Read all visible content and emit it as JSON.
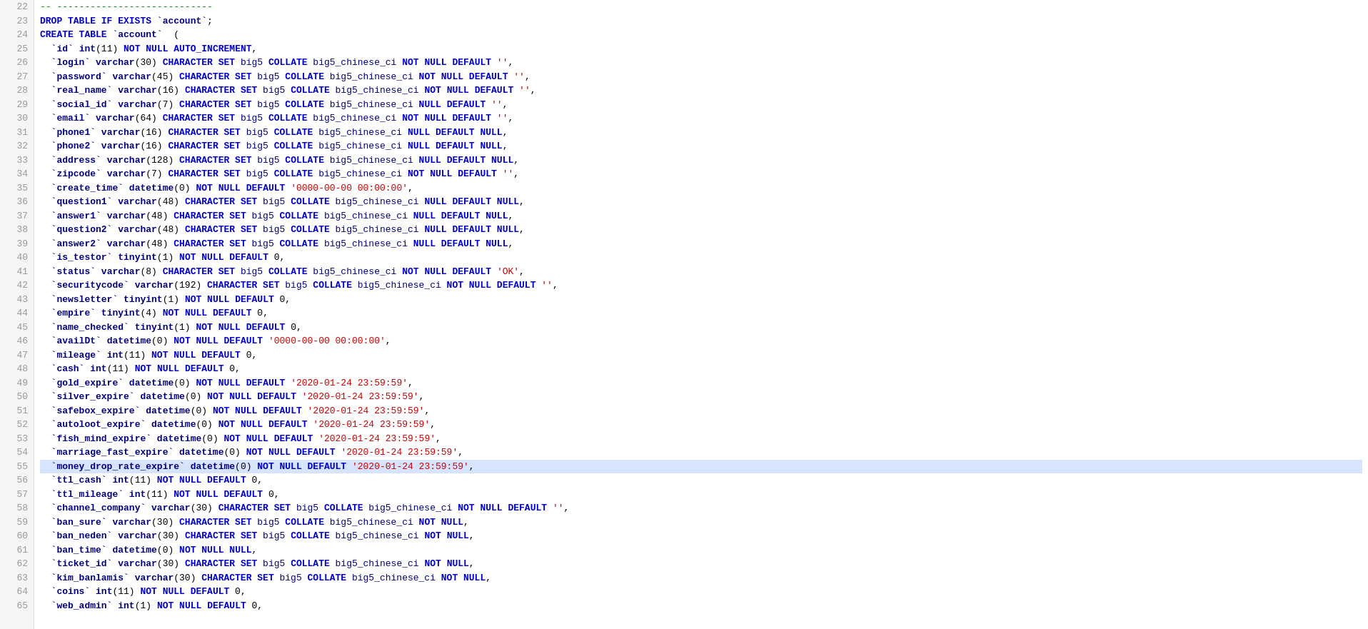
{
  "lines": [
    {
      "num": 22,
      "content": "-- ----------------------------",
      "type": "comment"
    },
    {
      "num": 23,
      "content": "DROP TABLE IF EXISTS `account`;",
      "type": "code"
    },
    {
      "num": 24,
      "content": "CREATE TABLE `account`  (",
      "type": "code"
    },
    {
      "num": 25,
      "content": "  `id` int(11) NOT NULL AUTO_INCREMENT,",
      "type": "code"
    },
    {
      "num": 26,
      "content": "  `login` varchar(30) CHARACTER SET big5 COLLATE big5_chinese_ci NOT NULL DEFAULT '',",
      "type": "code"
    },
    {
      "num": 27,
      "content": "  `password` varchar(45) CHARACTER SET big5 COLLATE big5_chinese_ci NOT NULL DEFAULT '',",
      "type": "code"
    },
    {
      "num": 28,
      "content": "  `real_name` varchar(16) CHARACTER SET big5 COLLATE big5_chinese_ci NOT NULL DEFAULT '',",
      "type": "code"
    },
    {
      "num": 29,
      "content": "  `social_id` varchar(7) CHARACTER SET big5 COLLATE big5_chinese_ci NULL DEFAULT '',",
      "type": "code"
    },
    {
      "num": 30,
      "content": "  `email` varchar(64) CHARACTER SET big5 COLLATE big5_chinese_ci NOT NULL DEFAULT '',",
      "type": "code"
    },
    {
      "num": 31,
      "content": "  `phone1` varchar(16) CHARACTER SET big5 COLLATE big5_chinese_ci NULL DEFAULT NULL,",
      "type": "code"
    },
    {
      "num": 32,
      "content": "  `phone2` varchar(16) CHARACTER SET big5 COLLATE big5_chinese_ci NULL DEFAULT NULL,",
      "type": "code"
    },
    {
      "num": 33,
      "content": "  `address` varchar(128) CHARACTER SET big5 COLLATE big5_chinese_ci NULL DEFAULT NULL,",
      "type": "code"
    },
    {
      "num": 34,
      "content": "  `zipcode` varchar(7) CHARACTER SET big5 COLLATE big5_chinese_ci NOT NULL DEFAULT '',",
      "type": "code"
    },
    {
      "num": 35,
      "content": "  `create_time` datetime(0) NOT NULL DEFAULT '0000-00-00 00:00:00',",
      "type": "code"
    },
    {
      "num": 36,
      "content": "  `question1` varchar(48) CHARACTER SET big5 COLLATE big5_chinese_ci NULL DEFAULT NULL,",
      "type": "code"
    },
    {
      "num": 37,
      "content": "  `answer1` varchar(48) CHARACTER SET big5 COLLATE big5_chinese_ci NULL DEFAULT NULL,",
      "type": "code"
    },
    {
      "num": 38,
      "content": "  `question2` varchar(48) CHARACTER SET big5 COLLATE big5_chinese_ci NULL DEFAULT NULL,",
      "type": "code"
    },
    {
      "num": 39,
      "content": "  `answer2` varchar(48) CHARACTER SET big5 COLLATE big5_chinese_ci NULL DEFAULT NULL,",
      "type": "code"
    },
    {
      "num": 40,
      "content": "  `is_testor` tinyint(1) NOT NULL DEFAULT 0,",
      "type": "code"
    },
    {
      "num": 41,
      "content": "  `status` varchar(8) CHARACTER SET big5 COLLATE big5_chinese_ci NOT NULL DEFAULT 'OK',",
      "type": "code"
    },
    {
      "num": 42,
      "content": "  `securitycode` varchar(192) CHARACTER SET big5 COLLATE big5_chinese_ci NOT NULL DEFAULT '',",
      "type": "code"
    },
    {
      "num": 43,
      "content": "  `newsletter` tinyint(1) NOT NULL DEFAULT 0,",
      "type": "code"
    },
    {
      "num": 44,
      "content": "  `empire` tinyint(4) NOT NULL DEFAULT 0,",
      "type": "code"
    },
    {
      "num": 45,
      "content": "  `name_checked` tinyint(1) NOT NULL DEFAULT 0,",
      "type": "code"
    },
    {
      "num": 46,
      "content": "  `availDt` datetime(0) NOT NULL DEFAULT '0000-00-00 00:00:00',",
      "type": "code"
    },
    {
      "num": 47,
      "content": "  `mileage` int(11) NOT NULL DEFAULT 0,",
      "type": "code"
    },
    {
      "num": 48,
      "content": "  `cash` int(11) NOT NULL DEFAULT 0,",
      "type": "code"
    },
    {
      "num": 49,
      "content": "  `gold_expire` datetime(0) NOT NULL DEFAULT '2020-01-24 23:59:59',",
      "type": "code"
    },
    {
      "num": 50,
      "content": "  `silver_expire` datetime(0) NOT NULL DEFAULT '2020-01-24 23:59:59',",
      "type": "code"
    },
    {
      "num": 51,
      "content": "  `safebox_expire` datetime(0) NOT NULL DEFAULT '2020-01-24 23:59:59',",
      "type": "code"
    },
    {
      "num": 52,
      "content": "  `autoloot_expire` datetime(0) NOT NULL DEFAULT '2020-01-24 23:59:59',",
      "type": "code"
    },
    {
      "num": 53,
      "content": "  `fish_mind_expire` datetime(0) NOT NULL DEFAULT '2020-01-24 23:59:59',",
      "type": "code"
    },
    {
      "num": 54,
      "content": "  `marriage_fast_expire` datetime(0) NOT NULL DEFAULT '2020-01-24 23:59:59',",
      "type": "code"
    },
    {
      "num": 55,
      "content": "  `money_drop_rate_expire` datetime(0) NOT NULL DEFAULT '2020-01-24 23:59:59',",
      "type": "code",
      "highlight": true
    },
    {
      "num": 56,
      "content": "  `ttl_cash` int(11) NOT NULL DEFAULT 0,",
      "type": "code"
    },
    {
      "num": 57,
      "content": "  `ttl_mileage` int(11) NOT NULL DEFAULT 0,",
      "type": "code"
    },
    {
      "num": 58,
      "content": "  `channel_company` varchar(30) CHARACTER SET big5 COLLATE big5_chinese_ci NOT NULL DEFAULT '',",
      "type": "code"
    },
    {
      "num": 59,
      "content": "  `ban_sure` varchar(30) CHARACTER SET big5 COLLATE big5_chinese_ci NOT NULL,",
      "type": "code"
    },
    {
      "num": 60,
      "content": "  `ban_neden` varchar(30) CHARACTER SET big5 COLLATE big5_chinese_ci NOT NULL,",
      "type": "code"
    },
    {
      "num": 61,
      "content": "  `ban_time` datetime(0) NOT NULL NULL,",
      "type": "code"
    },
    {
      "num": 62,
      "content": "  `ticket_id` varchar(30) CHARACTER SET big5 COLLATE big5_chinese_ci NOT NULL,",
      "type": "code"
    },
    {
      "num": 63,
      "content": "  `kim_banlamis` varchar(30) CHARACTER SET big5 COLLATE big5_chinese_ci NOT NULL,",
      "type": "code"
    },
    {
      "num": 64,
      "content": "  `coins` int(11) NOT NULL DEFAULT 0,",
      "type": "code"
    },
    {
      "num": 65,
      "content": "  `web_admin` int(1) NOT NULL DEFAULT 0,",
      "type": "code"
    }
  ]
}
